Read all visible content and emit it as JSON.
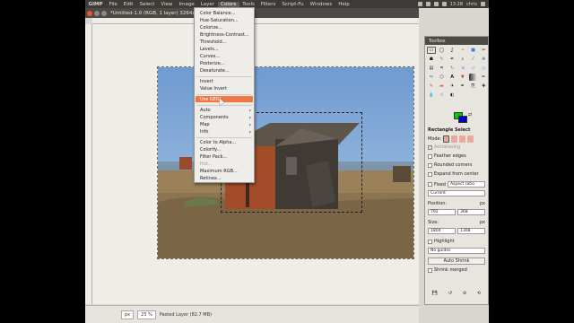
{
  "topbar": {
    "app_name": "GIMP",
    "menu_items": [
      "File",
      "Edit",
      "Select",
      "View",
      "Image",
      "Layer",
      "Colors",
      "Tools",
      "Filters",
      "Script-Fu",
      "Windows",
      "Help"
    ],
    "time": "13:28",
    "user": "chris"
  },
  "image_window": {
    "title": "*Untitled-1.0 (RGB, 1 layer) 3264x2448"
  },
  "colors_menu": {
    "items": [
      "Color Balance...",
      "Hue-Saturation...",
      "Colorize...",
      "Brightness-Contrast...",
      "Threshold...",
      "Levels...",
      "Curves...",
      "Posterize...",
      "Desaturate...",
      "Invert",
      "Value Invert",
      "Use GEGL",
      "Auto",
      "Components",
      "Map",
      "Info",
      "Color to Alpha...",
      "Colorify...",
      "Filter Pack...",
      "Hot...",
      "Maximum RGB...",
      "Retinex..."
    ],
    "highlighted": "Use GEGL"
  },
  "statusbar": {
    "unit": "px",
    "zoom": "25 %",
    "layer_info": "Pasted Layer (82.7 MB)"
  },
  "toolbox": {
    "title": "Toolbox",
    "tool_options_title": "Rectangle Select",
    "mode_label": "Mode:",
    "antialiasing": "Antialiasing",
    "feather_edges": "Feather edges",
    "rounded_corners": "Rounded corners",
    "expand_from_center": "Expand from center",
    "fixed_label": "Fixed",
    "fixed_value": "Aspect ratio",
    "current_value": "Current",
    "position_label": "Position:",
    "position_unit": "px",
    "position_x": "792",
    "position_y": "368",
    "size_label": "Size:",
    "size_unit": "px",
    "size_w": "1804",
    "size_h": "1308",
    "highlight": "Highlight",
    "guides": "No guides",
    "auto_shrink": "Auto Shrink",
    "shrink_merged": "Shrink merged"
  },
  "colors": {
    "accent": "#f07746",
    "fg_color": "#00cc00",
    "bg_color": "#0000cc"
  }
}
